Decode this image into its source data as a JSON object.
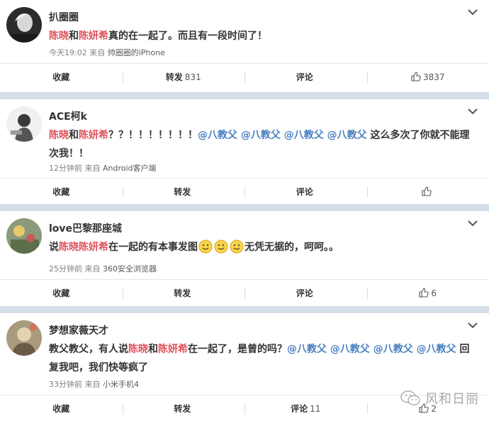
{
  "posts": [
    {
      "username": "扒圈圈",
      "content": [
        {
          "t": "陈晓",
          "c": "red"
        },
        {
          "t": "和",
          "c": ""
        },
        {
          "t": "陈妍希",
          "c": "red"
        },
        {
          "t": "真的在一起了。而且有一段时间了！",
          "c": ""
        }
      ],
      "time": "今天19:02",
      "from_label": "来自",
      "source": "帅圈圈的iPhone",
      "actions": {
        "collect": "收藏",
        "repost": "转发",
        "repost_count": "831",
        "comment": "评论",
        "comment_count": "",
        "like_count": "3837"
      }
    },
    {
      "username": "ACE柯k",
      "content": [
        {
          "t": "陈晓",
          "c": "red"
        },
        {
          "t": "和",
          "c": ""
        },
        {
          "t": "陈妍希",
          "c": "red"
        },
        {
          "t": "？？！！！！！！！",
          "c": ""
        },
        {
          "t": "@八教父 @八教父 @八教父 @八教父",
          "c": "blue"
        },
        {
          "t": " 这么多次了你就不能理次我！！",
          "c": ""
        }
      ],
      "time": "12分钟前",
      "from_label": "来自",
      "source": "Android客户端",
      "actions": {
        "collect": "收藏",
        "repost": "转发",
        "repost_count": "",
        "comment": "评论",
        "comment_count": "",
        "like_count": ""
      }
    },
    {
      "username": "love巴黎那座城",
      "content": [
        {
          "t": "说",
          "c": ""
        },
        {
          "t": "陈晓陈妍希",
          "c": "red"
        },
        {
          "t": "在一起的有本事发图",
          "c": ""
        },
        {
          "emoji": 3
        },
        {
          "t": "无凭无据的，呵呵。。",
          "c": ""
        }
      ],
      "time": "25分钟前",
      "from_label": "来自",
      "source": "360安全浏览器",
      "actions": {
        "collect": "收藏",
        "repost": "转发",
        "repost_count": "",
        "comment": "评论",
        "comment_count": "",
        "like_count": "6"
      }
    },
    {
      "username": "梦想家薇天才",
      "content": [
        {
          "t": "教父教父，有人说",
          "c": ""
        },
        {
          "t": "陈晓",
          "c": "red"
        },
        {
          "t": "和",
          "c": ""
        },
        {
          "t": "陈妍希",
          "c": "red"
        },
        {
          "t": "在一起了，是曾的吗？",
          "c": ""
        },
        {
          "t": "@八教父 @八教父 @八教父 @八教父",
          "c": "blue"
        },
        {
          "t": " 回复我吧，我们快等疯了",
          "c": ""
        }
      ],
      "time": "33分钟前",
      "from_label": "来自",
      "source": "小米手机4",
      "actions": {
        "collect": "收藏",
        "repost": "转发",
        "repost_count": "",
        "comment": "评论",
        "comment_count": "11",
        "like_count": "2"
      }
    }
  ],
  "watermark": "风和日丽",
  "colors": {
    "highlight": "#e0505a",
    "mention": "#4a7fc0",
    "divider_band": "#d4dde8"
  }
}
